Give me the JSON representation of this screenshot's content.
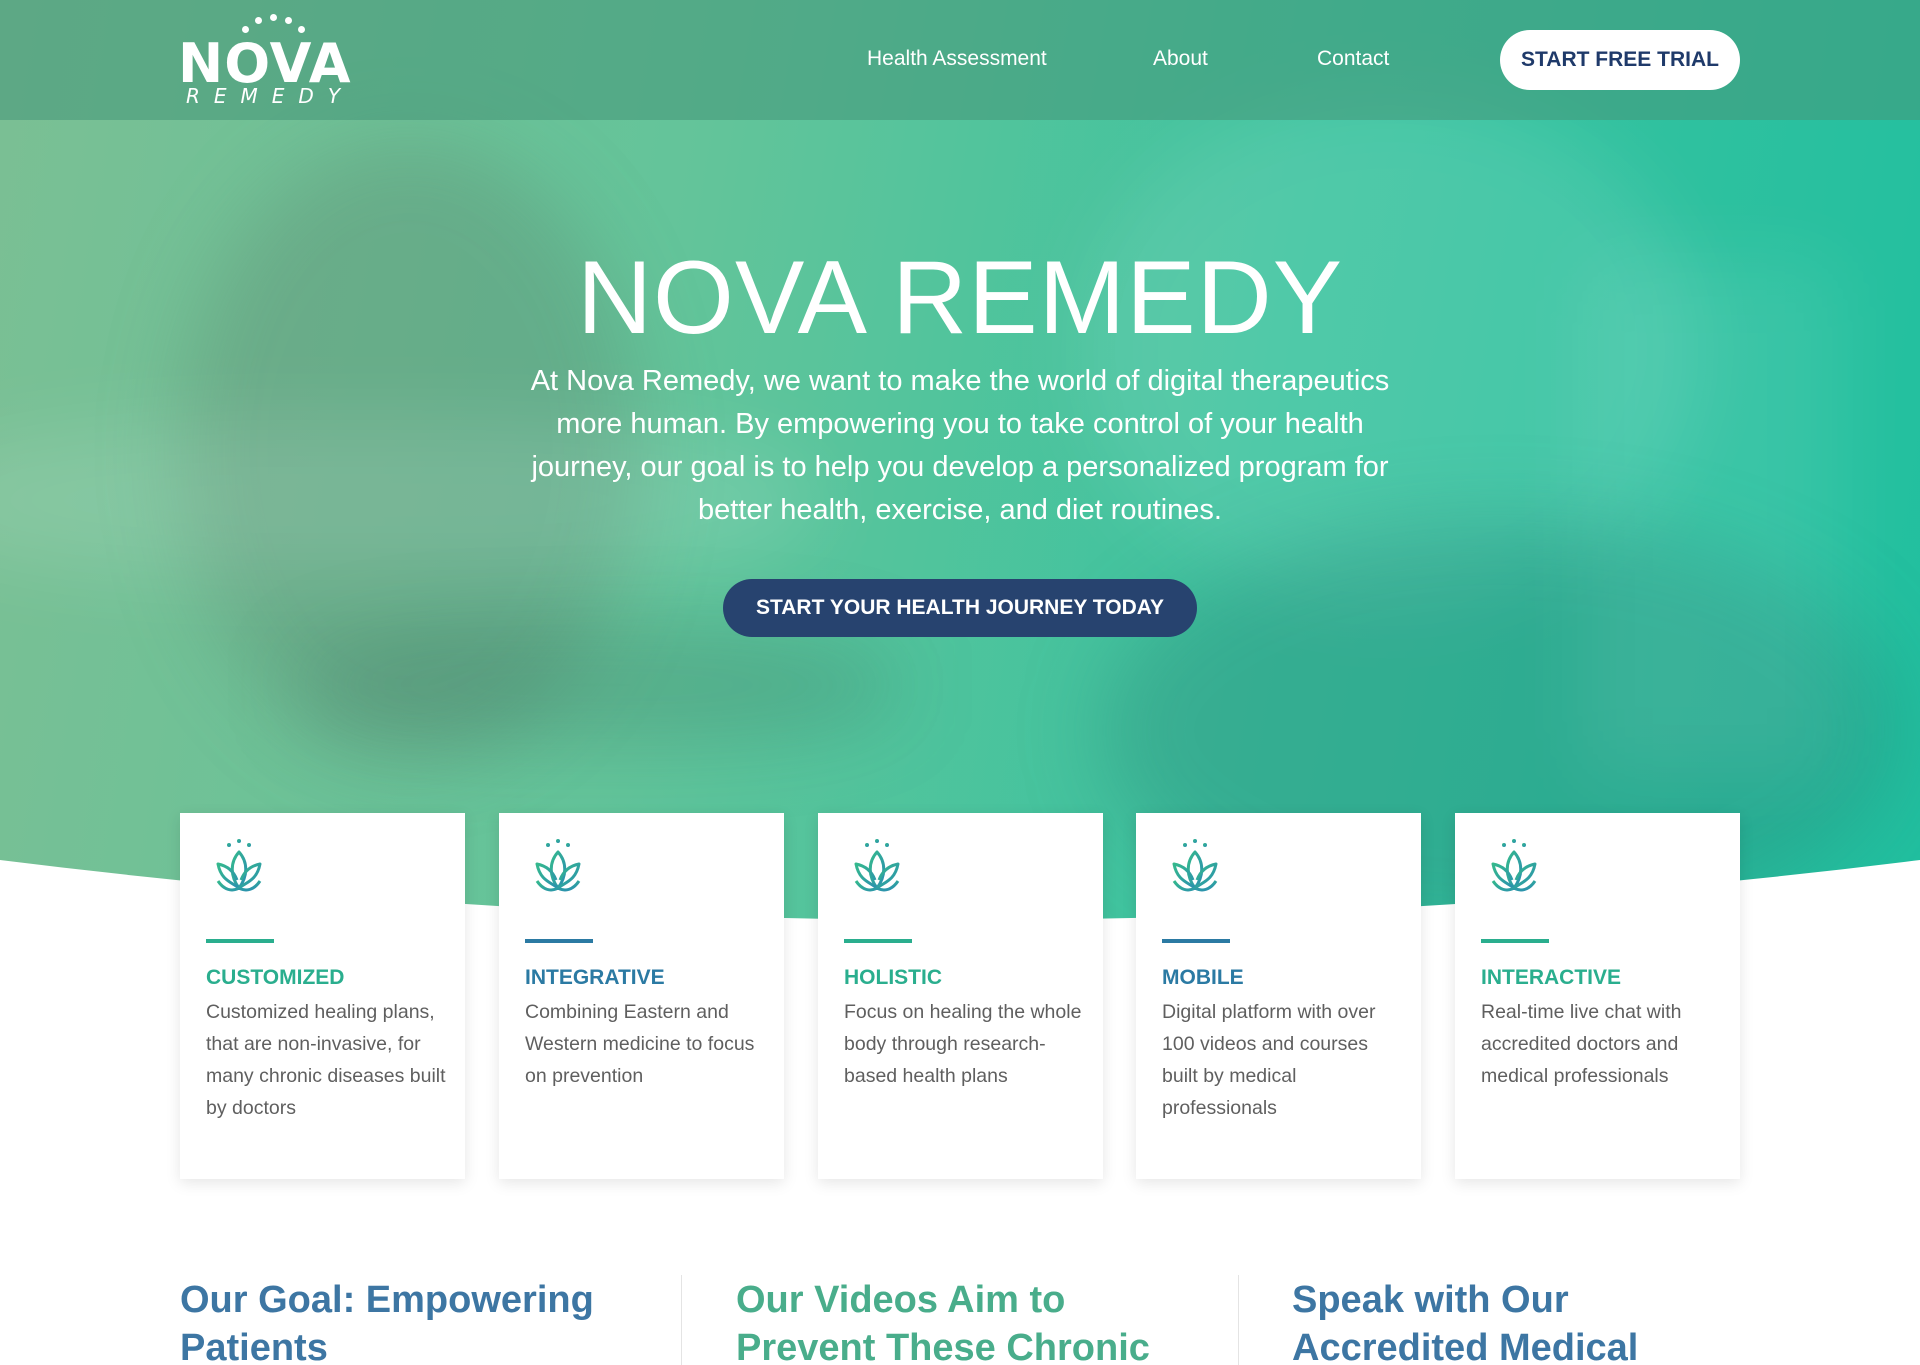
{
  "brand": {
    "logo_word": "NOVA",
    "logo_subword": "REMEDY"
  },
  "nav": {
    "links": [
      "Health Assessment",
      "About",
      "Contact"
    ],
    "trial_button": "START FREE TRIAL"
  },
  "hero": {
    "title": "NOVA REMEDY",
    "description": "At Nova Remedy, we want to make the world of digital therapeutics more human. By empowering you to take control of your health journey, our goal is to help you develop a personalized program for better health, exercise, and diet routines.",
    "cta_button": "START YOUR HEALTH JOURNEY TODAY"
  },
  "features": [
    {
      "icon": "lotus-icon",
      "title": "CUSTOMIZED",
      "text": "Customized healing plans, that are non-invasive, for many chronic diseases built by doctors",
      "accent": "green"
    },
    {
      "icon": "lotus-icon",
      "title": "INTEGRATIVE",
      "text": "Combining Eastern and Western medicine to focus on prevention",
      "accent": "blue"
    },
    {
      "icon": "lotus-icon",
      "title": "HOLISTIC",
      "text": "Focus on healing the whole body through research-based health plans",
      "accent": "green"
    },
    {
      "icon": "lotus-icon",
      "title": "MOBILE",
      "text": "Digital platform with over 100 videos and courses built by medical professionals",
      "accent": "blue"
    },
    {
      "icon": "lotus-icon",
      "title": "INTERACTIVE",
      "text": "Real-time live chat with accredited doctors and medical professionals",
      "accent": "green"
    }
  ],
  "sections": [
    {
      "title": "Our Goal: Empowering Patients",
      "color": "blue"
    },
    {
      "title": "Our Videos Aim to Prevent These Chronic",
      "color": "green"
    },
    {
      "title": "Speak with Our Accredited Medical",
      "color": "blue"
    }
  ],
  "colors": {
    "hero_start": "#7bbf94",
    "hero_end": "#20bf9f",
    "navy": "#27436f",
    "accent_green": "#2aae8e",
    "accent_blue": "#2b7aa3",
    "heading_blue": "#3d76a3",
    "heading_green": "#49ad8b",
    "body_text": "#5f5f5f"
  }
}
